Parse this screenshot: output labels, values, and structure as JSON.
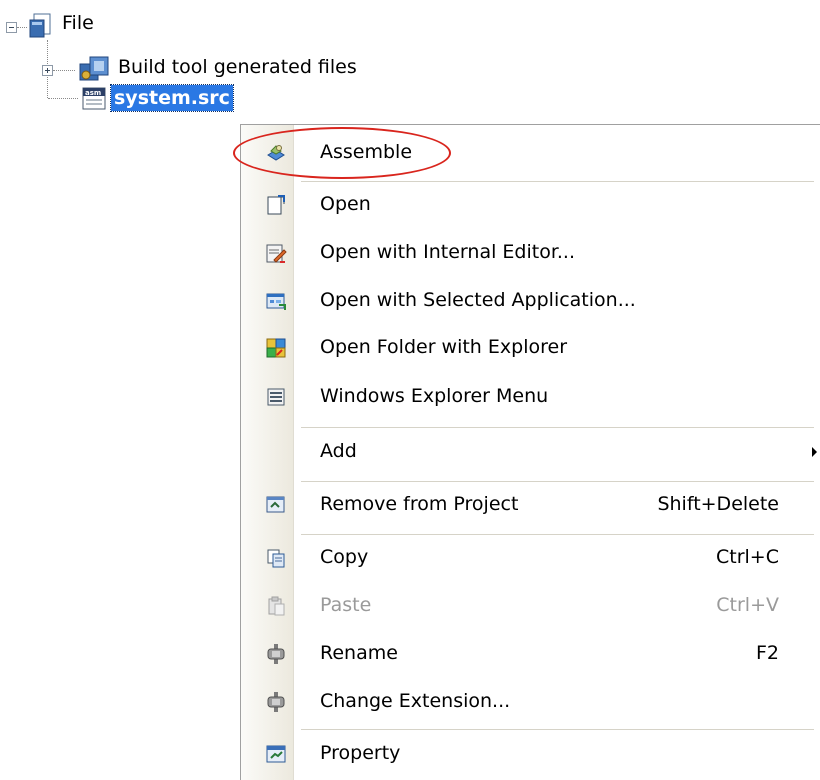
{
  "tree": {
    "root": {
      "label": "File",
      "icon": "file-folder-icon",
      "expanded": true
    },
    "children": [
      {
        "label": "Build tool generated files",
        "icon": "build-folder-icon",
        "expanded": false
      },
      {
        "label": "system.src",
        "icon": "asm-file-icon",
        "selected": true
      }
    ]
  },
  "menu": {
    "items": [
      {
        "label": "Assemble",
        "shortcut": "",
        "icon": "assemble-icon",
        "enabled": true,
        "highlighted": true
      },
      {
        "label": "Open",
        "shortcut": "",
        "icon": "open-icon",
        "enabled": true
      },
      {
        "label": "Open with Internal Editor...",
        "shortcut": "",
        "icon": "internal-editor-icon",
        "enabled": true
      },
      {
        "label": "Open with Selected Application...",
        "shortcut": "",
        "icon": "selected-application-icon",
        "enabled": true
      },
      {
        "label": "Open Folder with Explorer",
        "shortcut": "",
        "icon": "explorer-folder-icon",
        "enabled": true
      },
      {
        "label": "Windows Explorer Menu",
        "shortcut": "",
        "icon": "explorer-menu-icon",
        "enabled": true
      },
      {
        "label": "Add",
        "shortcut": "",
        "icon": "",
        "enabled": true,
        "submenu": true
      },
      {
        "label": "Remove from Project",
        "shortcut": "Shift+Delete",
        "icon": "remove-icon",
        "enabled": true
      },
      {
        "label": "Copy",
        "shortcut": "Ctrl+C",
        "icon": "copy-icon",
        "enabled": true
      },
      {
        "label": "Paste",
        "shortcut": "Ctrl+V",
        "icon": "paste-icon",
        "enabled": false
      },
      {
        "label": "Rename",
        "shortcut": "F2",
        "icon": "rename-icon",
        "enabled": true
      },
      {
        "label": "Change Extension...",
        "shortcut": "",
        "icon": "change-extension-icon",
        "enabled": true
      },
      {
        "label": "Property",
        "shortcut": "",
        "icon": "property-icon",
        "enabled": true
      }
    ]
  },
  "colors": {
    "selection": "#2a78e4",
    "highlight_ellipse": "#d9251d",
    "disabled_text": "#9a9a9a"
  }
}
